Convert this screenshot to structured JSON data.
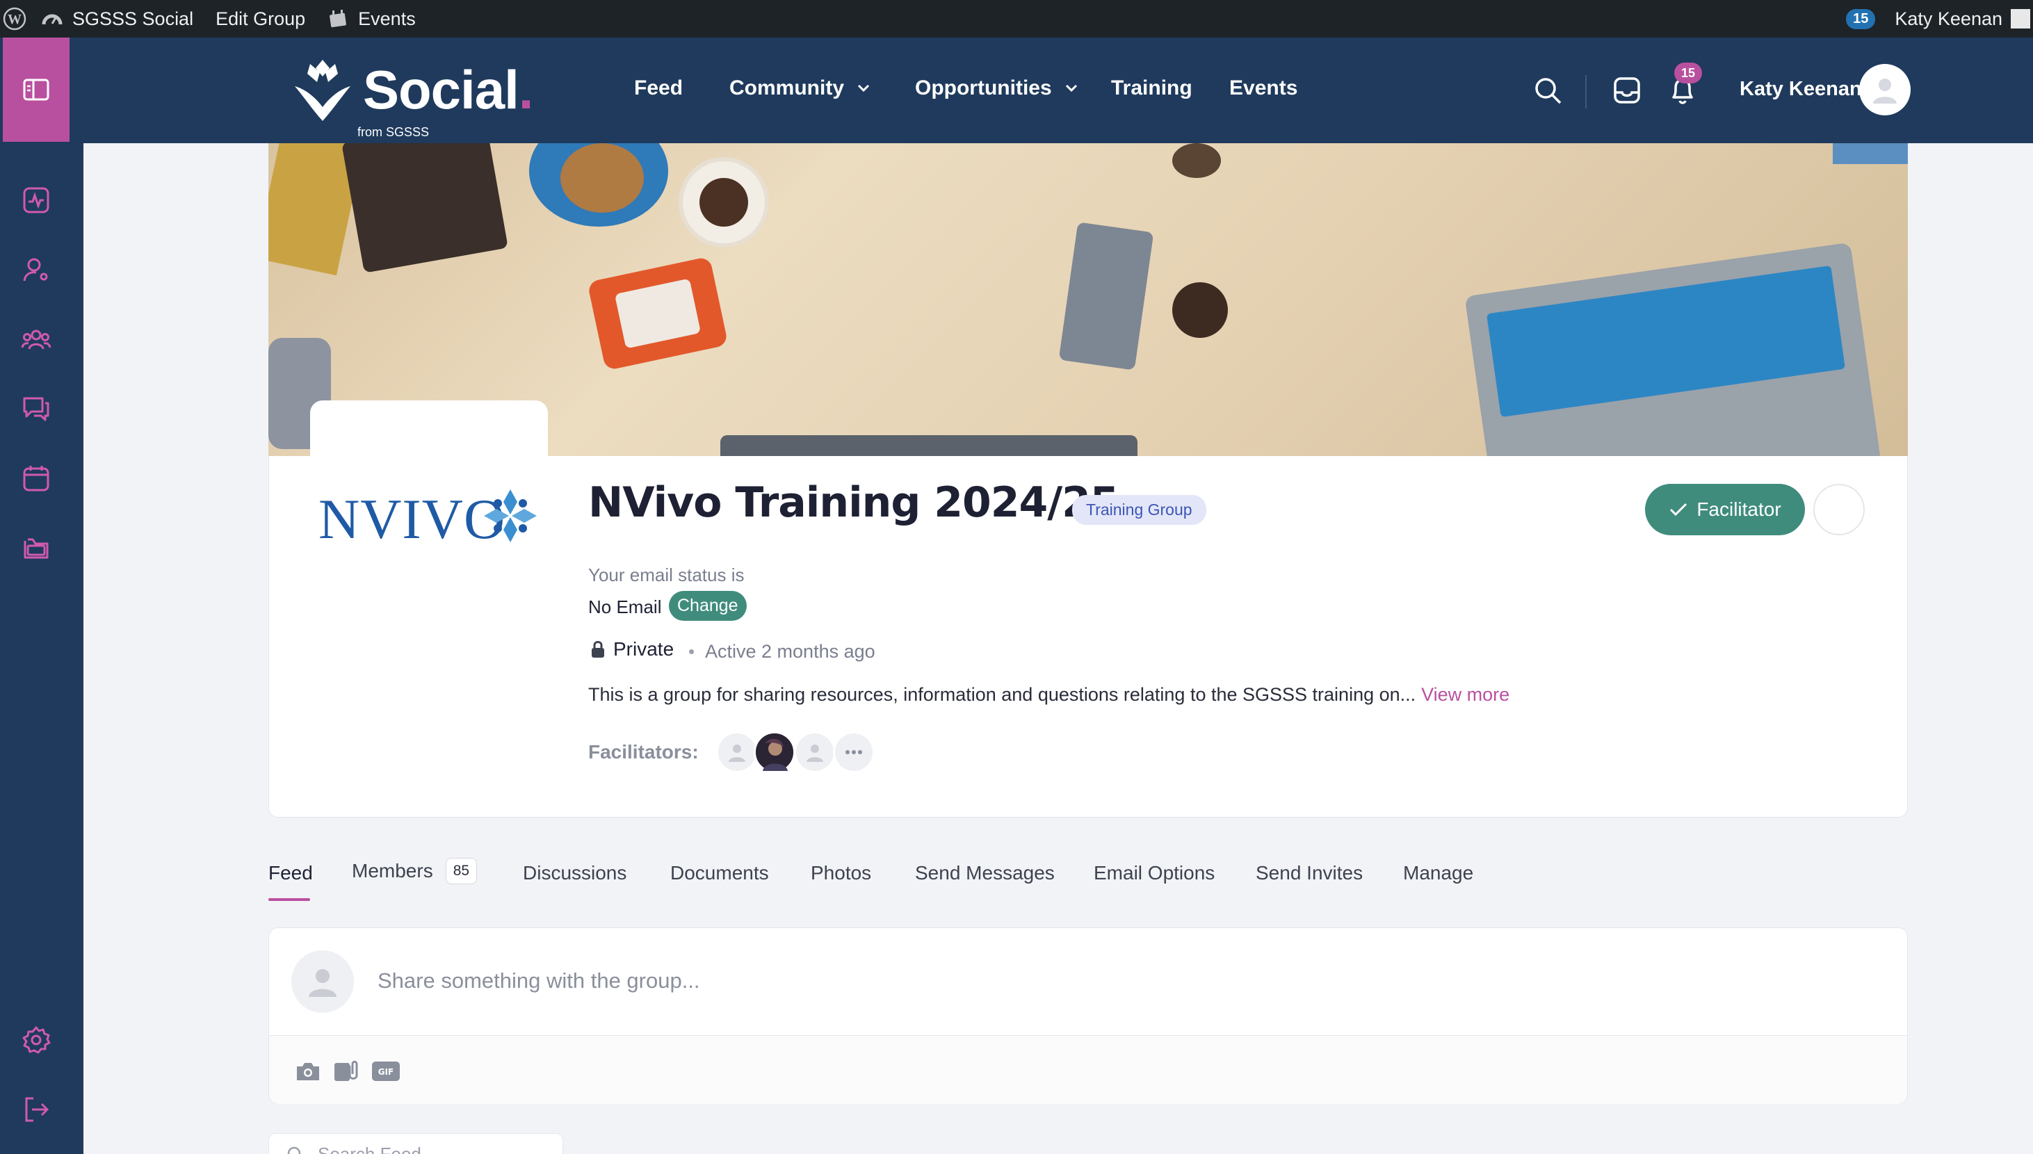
{
  "admin_bar": {
    "site_name": "SGSSS Social",
    "edit_group": "Edit Group",
    "events": "Events",
    "count": "15",
    "user_name": "Katy Keenan"
  },
  "header": {
    "brand": "Social",
    "brand_sub": "from SGSSS",
    "nav": [
      {
        "label": "Feed"
      },
      {
        "label": "Community"
      },
      {
        "label": "Opportunities"
      },
      {
        "label": "Training"
      },
      {
        "label": "Events"
      }
    ],
    "notification_count": "15",
    "user_name": "Katy Keenan"
  },
  "group": {
    "logo_text": "NVIVO",
    "title": "NVivo Training 2024/25",
    "type_badge": "Training Group",
    "role_button": "Facilitator",
    "email_status_label": "Your email status is",
    "email_status_value": "No Email",
    "change_button": "Change",
    "privacy": "Private",
    "activity": "Active 2 months ago",
    "description": "This is a group for sharing resources, information and questions relating to the SGSSS training on...",
    "view_more": "View more",
    "facilitators_label": "Facilitators:"
  },
  "tabs": [
    {
      "label": "Feed"
    },
    {
      "label": "Members",
      "count": "85"
    },
    {
      "label": "Discussions"
    },
    {
      "label": "Documents"
    },
    {
      "label": "Photos"
    },
    {
      "label": "Send Messages"
    },
    {
      "label": "Email Options"
    },
    {
      "label": "Send Invites"
    },
    {
      "label": "Manage"
    }
  ],
  "composer": {
    "placeholder": "Share something with the group..."
  },
  "search_feed": {
    "placeholder": "Search Feed"
  },
  "colors": {
    "navy": "#1f3a5c",
    "accent": "#b9509f",
    "green": "#3f8c7d"
  }
}
